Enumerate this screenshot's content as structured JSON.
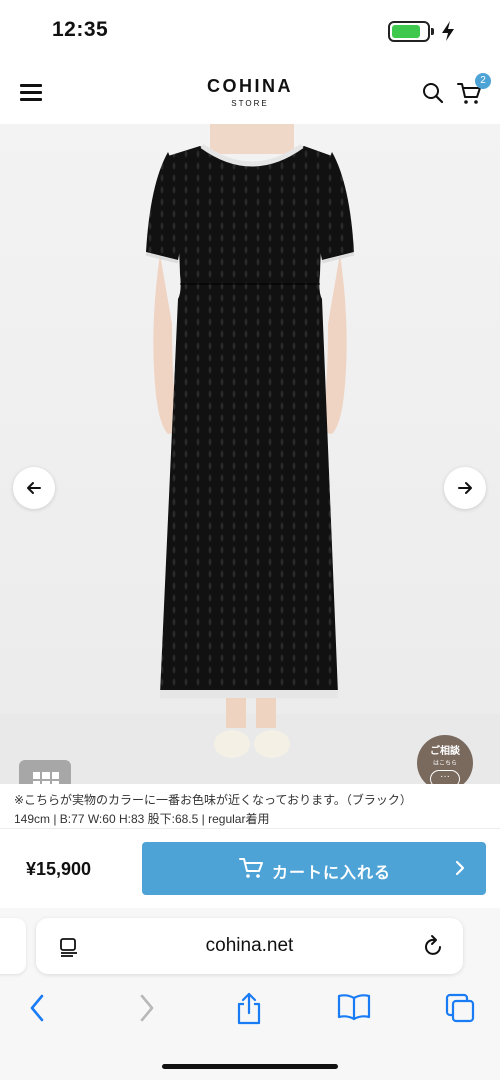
{
  "status_bar": {
    "time": "12:35",
    "battery_color": "#3ec84e"
  },
  "header": {
    "logo_name": "COHINA",
    "logo_sub": "STORE",
    "cart_count": "2",
    "accent": "#4ea3d6",
    "icons": [
      "menu-icon",
      "search-icon",
      "cart-icon"
    ]
  },
  "gallery": {
    "prev_icon": "arrow-left-icon",
    "next_icon": "arrow-right-icon",
    "consult": {
      "title": "ご相談",
      "sub": "はこちら",
      "bubble": "···"
    }
  },
  "captions": {
    "line1": "※こちらが実物のカラーに一番お色味が近くなっております。（ブラック）",
    "line2": "149cm | B:77 W:60 H:83 股下:68.5 | regular着用"
  },
  "buy": {
    "price": "¥15,900",
    "add_to_cart": "カートに入れる",
    "button_color": "#4ea3d6"
  },
  "browser": {
    "url": "cohina.net",
    "toolbar_icons": [
      "back-icon",
      "forward-icon",
      "share-icon",
      "bookmarks-icon",
      "tabs-icon"
    ]
  }
}
